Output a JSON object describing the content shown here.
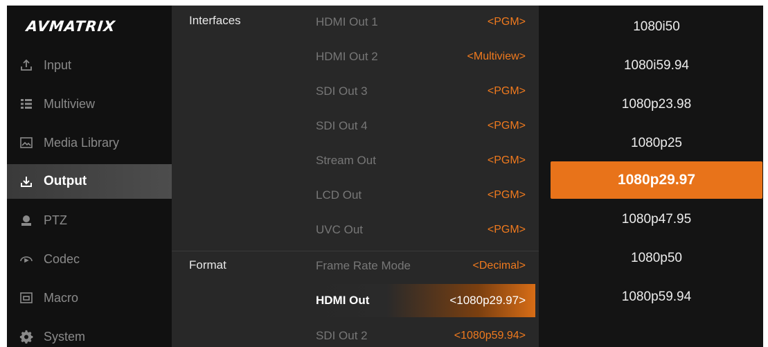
{
  "brand": {
    "logo_text": "AVMATRIX"
  },
  "sidebar": {
    "items": [
      {
        "label": "Input",
        "icon": "upload-icon",
        "active": false
      },
      {
        "label": "Multiview",
        "icon": "multiview-grid-icon",
        "active": false
      },
      {
        "label": "Media Library",
        "icon": "image-icon",
        "active": false
      },
      {
        "label": "Output",
        "icon": "download-icon",
        "active": true
      },
      {
        "label": "PTZ",
        "icon": "ptz-camera-icon",
        "active": false
      },
      {
        "label": "Codec",
        "icon": "codec-icon",
        "active": false
      },
      {
        "label": "Macro",
        "icon": "macro-icon",
        "active": false
      },
      {
        "label": "System",
        "icon": "gear-icon",
        "active": false
      }
    ]
  },
  "settings": {
    "sections": {
      "interfaces": "Interfaces",
      "format": "Format"
    },
    "rows": [
      {
        "label": "HDMI Out 1",
        "value": "<PGM>"
      },
      {
        "label": "HDMI Out 2",
        "value": "<Multiview>"
      },
      {
        "label": "SDI Out 3",
        "value": "<PGM>"
      },
      {
        "label": "SDI Out 4",
        "value": "<PGM>"
      },
      {
        "label": "Stream Out",
        "value": "<PGM>"
      },
      {
        "label": "LCD Out",
        "value": "<PGM>"
      },
      {
        "label": "UVC Out",
        "value": "<PGM>"
      },
      {
        "label": "Frame Rate Mode",
        "value": "<Decimal>"
      },
      {
        "label": "HDMI Out",
        "value": "<1080p29.97>",
        "selected": true
      },
      {
        "label": "SDI Out 2",
        "value": "<1080p59.94>"
      }
    ]
  },
  "options": {
    "items": [
      "1080i50",
      "1080i59.94",
      "1080p23.98",
      "1080p25",
      "1080p29.97",
      "1080p47.95",
      "1080p50",
      "1080p59.94"
    ],
    "selected": "1080p29.97"
  },
  "colors": {
    "accent": "#e8731a",
    "value_text": "#f07a1e",
    "background": "#1f1f1f"
  }
}
